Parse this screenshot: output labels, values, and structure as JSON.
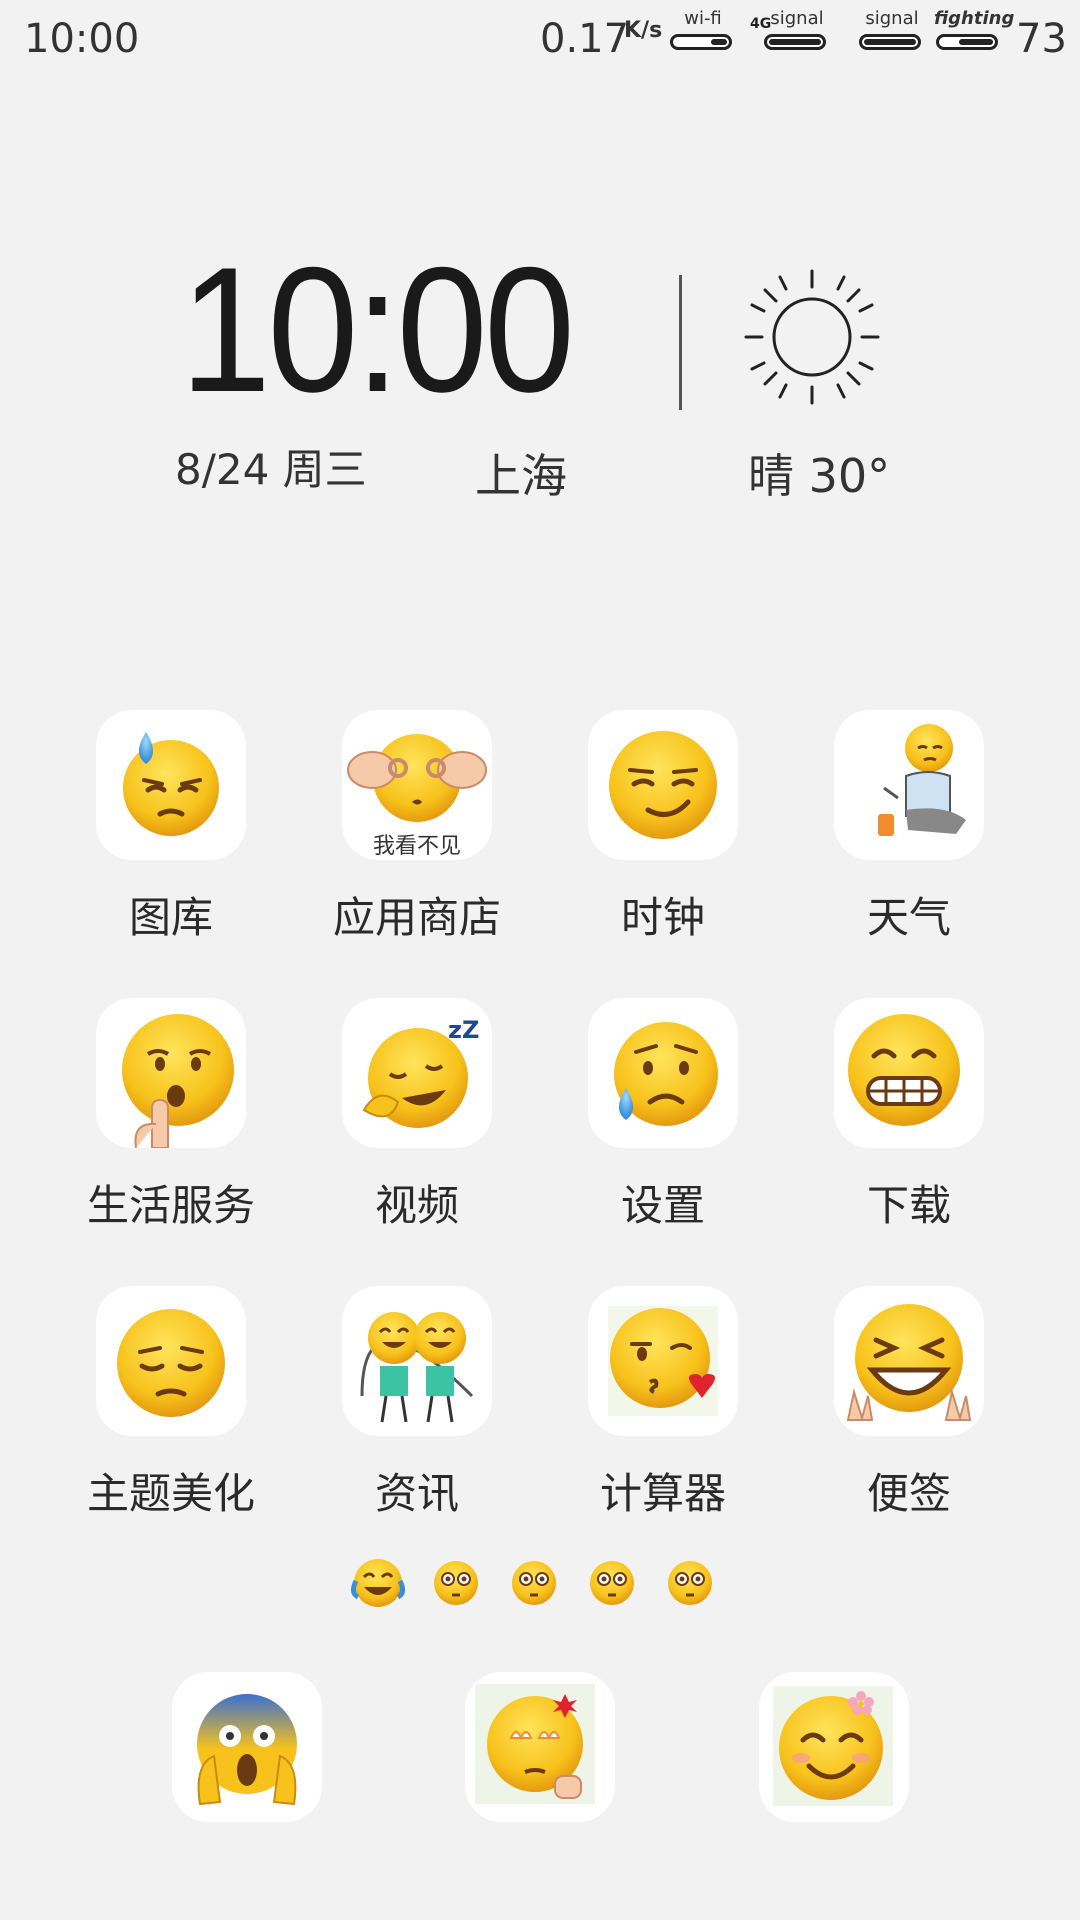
{
  "status_bar": {
    "time": "10:00",
    "net_speed": "0.17",
    "net_speed_unit": "K/s",
    "indicators": [
      {
        "label": "wi-fi",
        "fill": 0.3
      },
      {
        "label": "signal",
        "fill": 0.95,
        "prefix": "4G"
      },
      {
        "label": "signal",
        "fill": 0.95
      },
      {
        "label": "fighting",
        "fill": 0.6
      }
    ],
    "network_type": "4G",
    "battery": "73"
  },
  "clock_widget": {
    "time": "10:00",
    "date": "8/24 周三",
    "city": "上海",
    "weather": "晴 30°",
    "weather_icon": "sun-icon"
  },
  "apps": [
    {
      "label": "图库",
      "icon": "sweat-downcast-face-icon"
    },
    {
      "label": "应用商店",
      "icon": "hands-over-eyes-face-icon",
      "caption": "我看不见"
    },
    {
      "label": "时钟",
      "icon": "smirk-face-icon"
    },
    {
      "label": "天气",
      "icon": "sitting-sad-person-icon"
    },
    {
      "label": "生活服务",
      "icon": "shush-face-icon"
    },
    {
      "label": "视频",
      "icon": "sleepy-laugh-face-icon"
    },
    {
      "label": "设置",
      "icon": "worried-sweat-face-icon"
    },
    {
      "label": "下载",
      "icon": "grimace-face-icon"
    },
    {
      "label": "主题美化",
      "icon": "pensive-face-icon"
    },
    {
      "label": "资讯",
      "icon": "jump-rope-kids-icon"
    },
    {
      "label": "计算器",
      "icon": "kiss-heart-face-icon"
    },
    {
      "label": "便签",
      "icon": "laughing-peace-face-icon"
    }
  ],
  "page_indicator": {
    "current_page": 1,
    "total_pages": 5,
    "active_icon": "tears-of-joy-icon",
    "inactive_icon": "flushed-face-icon"
  },
  "dock": [
    {
      "icon": "screaming-face-icon"
    },
    {
      "icon": "fired-up-face-icon"
    },
    {
      "icon": "smiling-flower-face-icon"
    }
  ],
  "colors": {
    "background": "#f2f2f2",
    "tile": "#ffffff",
    "emoji_yellow": "#f7c21b",
    "text": "#2a2a2a"
  }
}
